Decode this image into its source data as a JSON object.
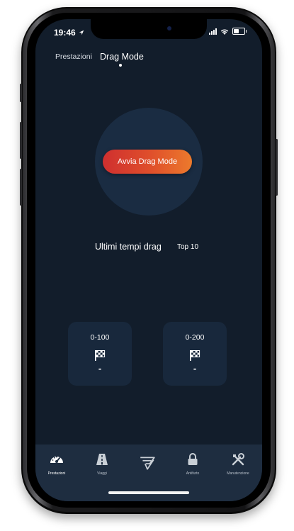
{
  "status_bar": {
    "time": "19:46"
  },
  "tabs": [
    {
      "label": "Prestazioni",
      "active": false
    },
    {
      "label": "Drag Mode",
      "active": true
    }
  ],
  "drag": {
    "start_label": "Avvia Drag Mode"
  },
  "recent": {
    "title": "Ultimi tempi drag",
    "top_label": "Top 10"
  },
  "cards": [
    {
      "label": "0-100",
      "value": "-",
      "icon": "checkered-flag-icon"
    },
    {
      "label": "0-200",
      "value": "-",
      "icon": "checkered-flag-icon"
    }
  ],
  "nav": [
    {
      "label": "Prestazioni",
      "icon": "speedometer-icon",
      "active": true
    },
    {
      "label": "Viaggi",
      "icon": "road-icon",
      "active": false
    },
    {
      "label": "",
      "icon": "brand-logo-icon",
      "active": false
    },
    {
      "label": "Antifurto",
      "icon": "lock-icon",
      "active": false
    },
    {
      "label": "Manutenzione",
      "icon": "tools-icon",
      "active": false
    }
  ],
  "colors": {
    "background": "#121d2b",
    "card": "#18283c",
    "nav_background": "#1e2d40",
    "accent_start": "#cf2f2f",
    "accent_end": "#ec7a2c"
  }
}
